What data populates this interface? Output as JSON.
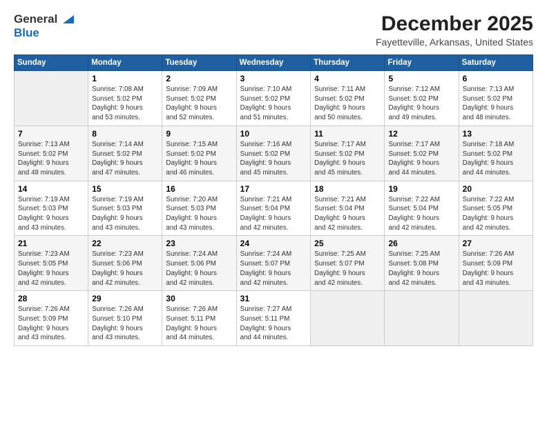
{
  "header": {
    "logo": {
      "line1": "General",
      "line2": "Blue"
    },
    "title": "December 2025",
    "subtitle": "Fayetteville, Arkansas, United States"
  },
  "days_of_week": [
    "Sunday",
    "Monday",
    "Tuesday",
    "Wednesday",
    "Thursday",
    "Friday",
    "Saturday"
  ],
  "weeks": [
    [
      {
        "day": "",
        "info": ""
      },
      {
        "day": "1",
        "info": "Sunrise: 7:08 AM\nSunset: 5:02 PM\nDaylight: 9 hours\nand 53 minutes."
      },
      {
        "day": "2",
        "info": "Sunrise: 7:09 AM\nSunset: 5:02 PM\nDaylight: 9 hours\nand 52 minutes."
      },
      {
        "day": "3",
        "info": "Sunrise: 7:10 AM\nSunset: 5:02 PM\nDaylight: 9 hours\nand 51 minutes."
      },
      {
        "day": "4",
        "info": "Sunrise: 7:11 AM\nSunset: 5:02 PM\nDaylight: 9 hours\nand 50 minutes."
      },
      {
        "day": "5",
        "info": "Sunrise: 7:12 AM\nSunset: 5:02 PM\nDaylight: 9 hours\nand 49 minutes."
      },
      {
        "day": "6",
        "info": "Sunrise: 7:13 AM\nSunset: 5:02 PM\nDaylight: 9 hours\nand 48 minutes."
      }
    ],
    [
      {
        "day": "7",
        "info": "Sunrise: 7:13 AM\nSunset: 5:02 PM\nDaylight: 9 hours\nand 48 minutes."
      },
      {
        "day": "8",
        "info": "Sunrise: 7:14 AM\nSunset: 5:02 PM\nDaylight: 9 hours\nand 47 minutes."
      },
      {
        "day": "9",
        "info": "Sunrise: 7:15 AM\nSunset: 5:02 PM\nDaylight: 9 hours\nand 46 minutes."
      },
      {
        "day": "10",
        "info": "Sunrise: 7:16 AM\nSunset: 5:02 PM\nDaylight: 9 hours\nand 45 minutes."
      },
      {
        "day": "11",
        "info": "Sunrise: 7:17 AM\nSunset: 5:02 PM\nDaylight: 9 hours\nand 45 minutes."
      },
      {
        "day": "12",
        "info": "Sunrise: 7:17 AM\nSunset: 5:02 PM\nDaylight: 9 hours\nand 44 minutes."
      },
      {
        "day": "13",
        "info": "Sunrise: 7:18 AM\nSunset: 5:02 PM\nDaylight: 9 hours\nand 44 minutes."
      }
    ],
    [
      {
        "day": "14",
        "info": "Sunrise: 7:19 AM\nSunset: 5:03 PM\nDaylight: 9 hours\nand 43 minutes."
      },
      {
        "day": "15",
        "info": "Sunrise: 7:19 AM\nSunset: 5:03 PM\nDaylight: 9 hours\nand 43 minutes."
      },
      {
        "day": "16",
        "info": "Sunrise: 7:20 AM\nSunset: 5:03 PM\nDaylight: 9 hours\nand 43 minutes."
      },
      {
        "day": "17",
        "info": "Sunrise: 7:21 AM\nSunset: 5:04 PM\nDaylight: 9 hours\nand 42 minutes."
      },
      {
        "day": "18",
        "info": "Sunrise: 7:21 AM\nSunset: 5:04 PM\nDaylight: 9 hours\nand 42 minutes."
      },
      {
        "day": "19",
        "info": "Sunrise: 7:22 AM\nSunset: 5:04 PM\nDaylight: 9 hours\nand 42 minutes."
      },
      {
        "day": "20",
        "info": "Sunrise: 7:22 AM\nSunset: 5:05 PM\nDaylight: 9 hours\nand 42 minutes."
      }
    ],
    [
      {
        "day": "21",
        "info": "Sunrise: 7:23 AM\nSunset: 5:05 PM\nDaylight: 9 hours\nand 42 minutes."
      },
      {
        "day": "22",
        "info": "Sunrise: 7:23 AM\nSunset: 5:06 PM\nDaylight: 9 hours\nand 42 minutes."
      },
      {
        "day": "23",
        "info": "Sunrise: 7:24 AM\nSunset: 5:06 PM\nDaylight: 9 hours\nand 42 minutes."
      },
      {
        "day": "24",
        "info": "Sunrise: 7:24 AM\nSunset: 5:07 PM\nDaylight: 9 hours\nand 42 minutes."
      },
      {
        "day": "25",
        "info": "Sunrise: 7:25 AM\nSunset: 5:07 PM\nDaylight: 9 hours\nand 42 minutes."
      },
      {
        "day": "26",
        "info": "Sunrise: 7:25 AM\nSunset: 5:08 PM\nDaylight: 9 hours\nand 42 minutes."
      },
      {
        "day": "27",
        "info": "Sunrise: 7:26 AM\nSunset: 5:09 PM\nDaylight: 9 hours\nand 43 minutes."
      }
    ],
    [
      {
        "day": "28",
        "info": "Sunrise: 7:26 AM\nSunset: 5:09 PM\nDaylight: 9 hours\nand 43 minutes."
      },
      {
        "day": "29",
        "info": "Sunrise: 7:26 AM\nSunset: 5:10 PM\nDaylight: 9 hours\nand 43 minutes."
      },
      {
        "day": "30",
        "info": "Sunrise: 7:26 AM\nSunset: 5:11 PM\nDaylight: 9 hours\nand 44 minutes."
      },
      {
        "day": "31",
        "info": "Sunrise: 7:27 AM\nSunset: 5:11 PM\nDaylight: 9 hours\nand 44 minutes."
      },
      {
        "day": "",
        "info": ""
      },
      {
        "day": "",
        "info": ""
      },
      {
        "day": "",
        "info": ""
      }
    ]
  ]
}
